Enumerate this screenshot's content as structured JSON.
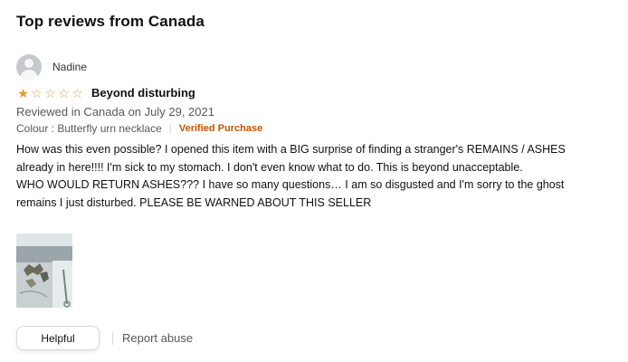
{
  "section": {
    "title": "Top reviews from Canada"
  },
  "review": {
    "author": "Nadine",
    "rating": 1,
    "rating_max": 5,
    "title": "Beyond disturbing",
    "date": "Reviewed in Canada on July 29, 2021",
    "variant": "Colour : Butterfly urn necklace",
    "verified": "Verified Purchase",
    "body_line1": "How was this even possible? I opened this item with a BIG surprise of finding a stranger's REMAINS / ASHES already in here!!!! I'm sick to my stomach. I don't even know what to do. This is beyond unacceptable.",
    "body_line2": "WHO WOULD RETURN ASHES??? I have so many questions… I am so disgusted and I'm sorry to the ghost remains I just disturbed. PLEASE BE WARNED ABOUT THIS SELLER"
  },
  "actions": {
    "helpful": "Helpful",
    "report": "Report abuse"
  },
  "colors": {
    "star": "#e89a2b",
    "verified": "#c45500",
    "text": "#0f1111",
    "muted": "#565959"
  },
  "icons": {
    "avatar": "default-user-avatar-icon",
    "star": "star-icon"
  }
}
